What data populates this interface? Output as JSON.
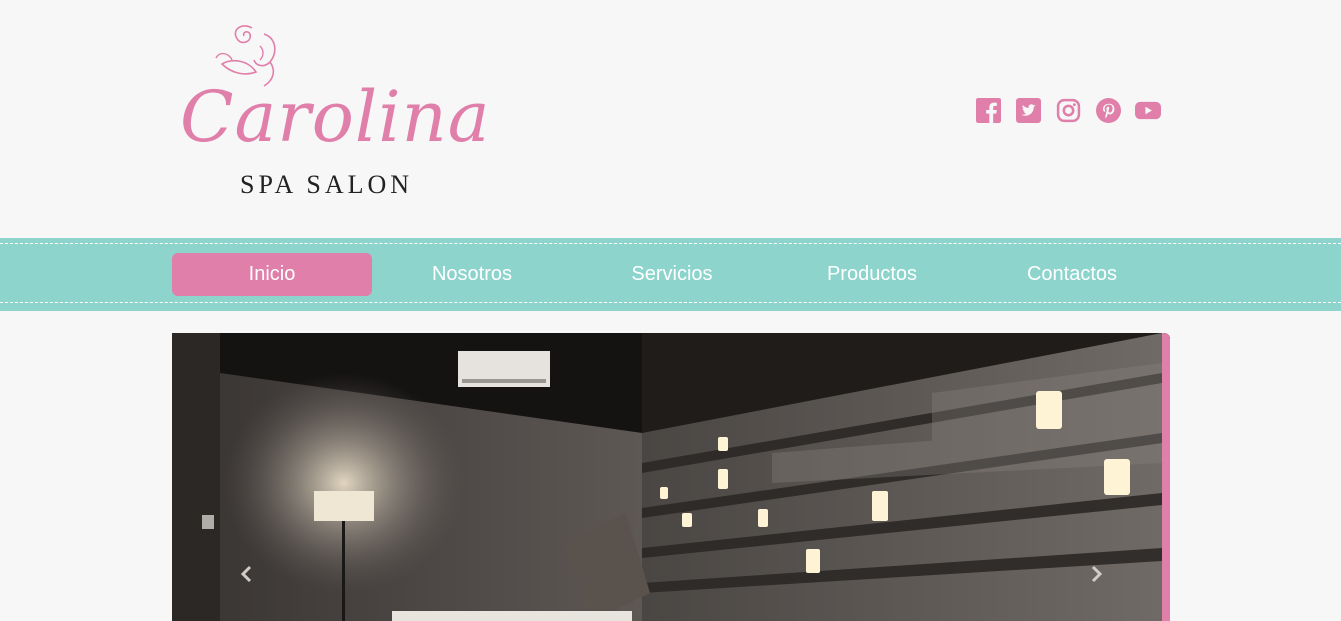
{
  "brand": {
    "name": "Carolina",
    "tagline": "SPA SALON"
  },
  "social": [
    "facebook-icon",
    "twitter-icon",
    "instagram-icon",
    "pinterest-icon",
    "youtube-icon"
  ],
  "nav": {
    "items": [
      {
        "label": "Inicio",
        "active": true
      },
      {
        "label": "Nosotros"
      },
      {
        "label": "Servicios"
      },
      {
        "label": "Productos"
      },
      {
        "label": "Contactos"
      }
    ]
  },
  "carousel": {
    "prev_icon": "chevron-left-icon",
    "next_icon": "chevron-right-icon"
  },
  "colors": {
    "pink": "#e07fa9",
    "teal": "#8dd4cd",
    "background": "#f7f7f7"
  }
}
